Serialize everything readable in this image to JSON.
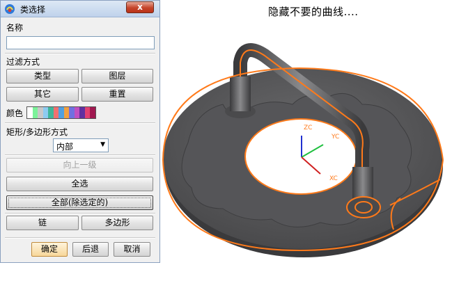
{
  "dialog": {
    "title": "类选择",
    "close_symbol": "x",
    "name_label": "名称",
    "name_value": "",
    "filter_label": "过滤方式",
    "filter_buttons": [
      "类型",
      "图层",
      "其它",
      "重置"
    ],
    "color_label": "颜色",
    "color_swatches": [
      "#ffffff",
      "#7cf29a",
      "#c8c8c8",
      "#8ecbf0",
      "#3fb59a",
      "#f07070",
      "#4fa0e0",
      "#f0a040",
      "#7070e0",
      "#c050c0",
      "#6030a0",
      "#e04070",
      "#a01850"
    ],
    "rect_label": "矩形/多边形方式",
    "rect_mode": "内部",
    "up_level": "向上一级",
    "select_all": "全选",
    "all_except": "全部(除选定的)",
    "chain": "链",
    "polygon": "多边形",
    "ok": "确定",
    "back": "后退",
    "cancel": "取消"
  },
  "viewport": {
    "prompt": "隐藏不要的曲线....",
    "axes": {
      "z_label": "ZC",
      "y_label": "YC",
      "x_label": "XC"
    },
    "highlight_color": "#ff7a1a",
    "model_color": "#5a5a5c"
  }
}
